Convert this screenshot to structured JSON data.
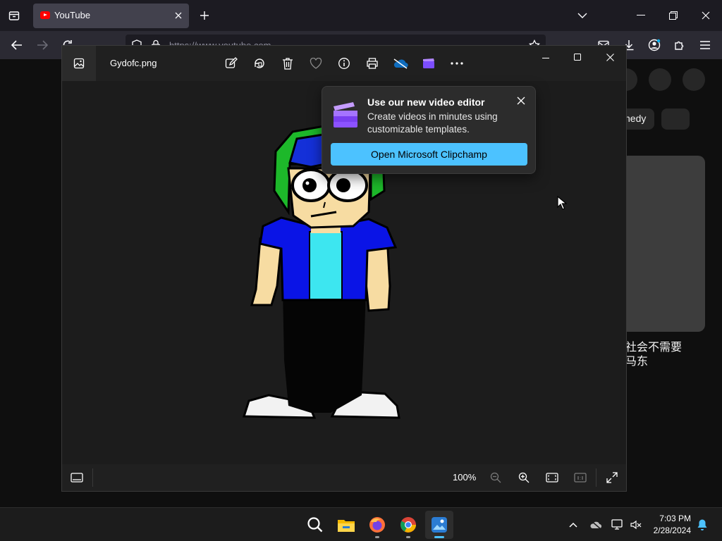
{
  "browser": {
    "tab": {
      "title": "YouTube",
      "favicon": "youtube-favicon-icon"
    },
    "url": "https://www.youtube.com",
    "accent": "#42414d"
  },
  "youtube": {
    "chip_comedy": "nedy",
    "video_title": "社会不需要\n马东"
  },
  "photos": {
    "file_name": "Gydofc.png",
    "toolbar_icons": [
      "edit-image-icon",
      "rotate-icon",
      "delete-icon",
      "favorite-icon",
      "info-icon",
      "print-icon",
      "onedrive-icon",
      "clipchamp-icon",
      "more-icon"
    ],
    "zoom_level": "100%"
  },
  "popup": {
    "title": "Use our new video editor",
    "body": "Create videos in minutes using customizable templates.",
    "cta": "Open Microsoft Clipchamp",
    "cta_color": "#4cc2ff"
  },
  "taskbar": {
    "apps": [
      "search-icon",
      "file-explorer-icon",
      "firefox-icon",
      "chrome-icon",
      "photos-icon"
    ],
    "time": "7:03 PM",
    "date": "2/28/2024"
  }
}
